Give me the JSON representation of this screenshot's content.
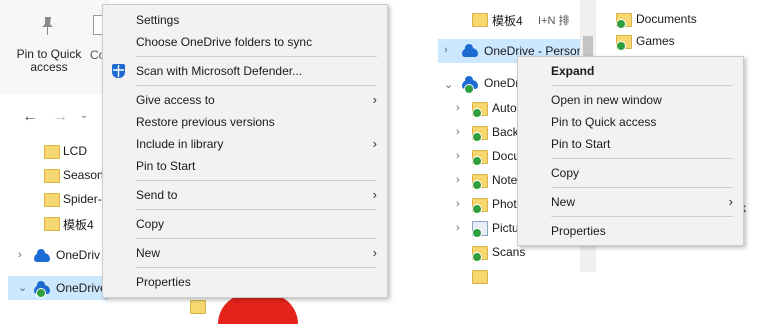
{
  "left_pane": {
    "ribbon": {
      "pin_quick_access": "Pin to Quick\naccess",
      "truncated_label": "Co"
    },
    "nav_tree": [
      {
        "label": "LCD"
      },
      {
        "label": "Season"
      },
      {
        "label": "Spider-"
      },
      {
        "label": "模板4"
      }
    ],
    "onedrive_rows": [
      {
        "label": "OneDriv"
      },
      {
        "label": "OneDrive"
      }
    ]
  },
  "left_menu": {
    "items": [
      {
        "label": "Settings"
      },
      {
        "label": "Choose OneDrive folders to sync"
      },
      {
        "label": "Scan with Microsoft Defender..."
      },
      {
        "label": "Give access to"
      },
      {
        "label": "Restore previous versions"
      },
      {
        "label": "Include in library"
      },
      {
        "label": "Pin to Start"
      },
      {
        "label": "Send to"
      },
      {
        "label": "Copy"
      },
      {
        "label": "New"
      },
      {
        "label": "Properties"
      }
    ]
  },
  "right_pane": {
    "top_item": "模板4",
    "top_item_suffix": "I+N 排",
    "onedrive_personal": "OneDrive - Persor",
    "onedrive_second": "OneDri",
    "tree": [
      {
        "label": "Auto"
      },
      {
        "label": "Back"
      },
      {
        "label": "Docu"
      },
      {
        "label": "Note"
      },
      {
        "label": "Phot"
      },
      {
        "label": "Pictu"
      },
      {
        "label": "Scans"
      }
    ],
    "right_list": [
      {
        "label": "Documents"
      },
      {
        "label": "Games"
      }
    ],
    "stray_letter": "k"
  },
  "right_menu": {
    "items": [
      {
        "label": "Expand"
      },
      {
        "label": "Open in new window"
      },
      {
        "label": "Pin to Quick access"
      },
      {
        "label": "Pin to Start"
      },
      {
        "label": "Copy"
      },
      {
        "label": "New"
      },
      {
        "label": "Properties"
      }
    ]
  },
  "colors": {
    "menu_bg": "#f2f2f2",
    "selection": "#cce8ff",
    "folder": "#f6d770",
    "sync_check": "#2e9e3e",
    "onedrive_blue": "#1c6bd3"
  }
}
